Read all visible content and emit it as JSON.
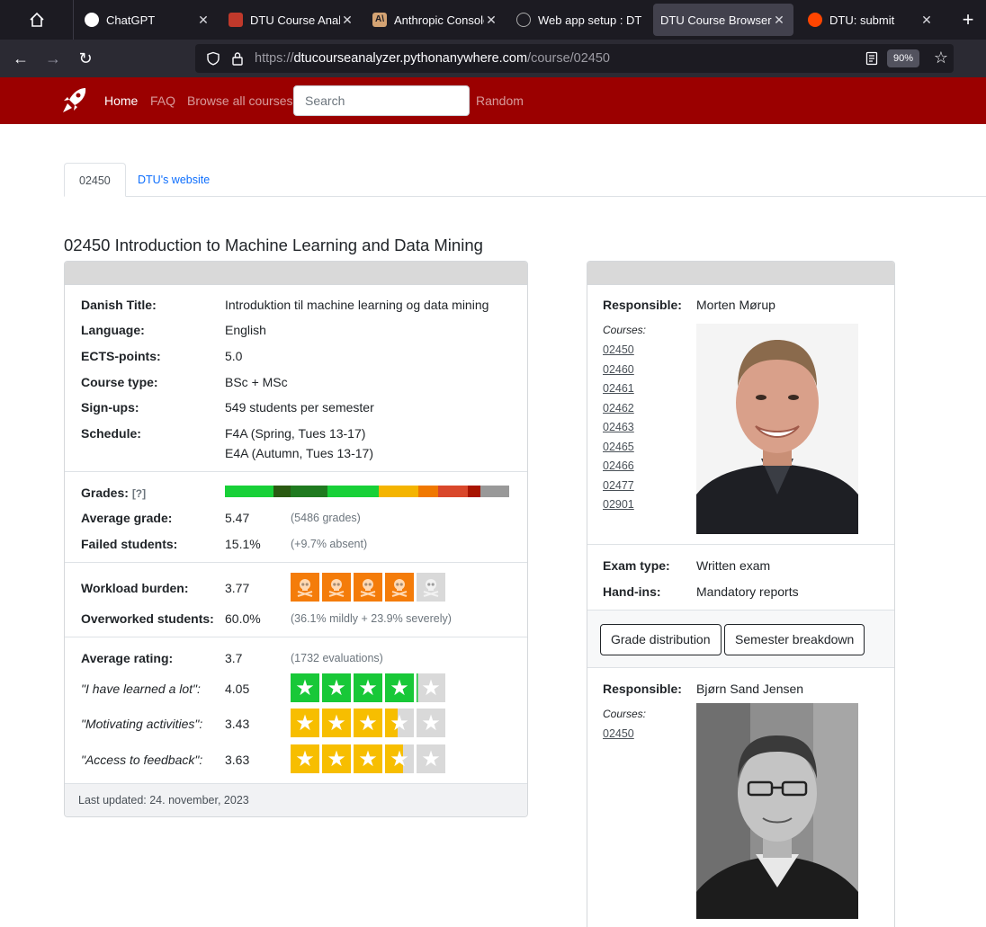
{
  "browser": {
    "tabs": [
      {
        "title": "ChatGPT",
        "color": "#ffffff"
      },
      {
        "title": "DTU Course Analyze",
        "color": "#c0392b"
      },
      {
        "title": "Anthropic Console",
        "color": "#d4a373"
      },
      {
        "title": "Web app setup : DTU",
        "color": "#1c1b22"
      },
      {
        "title": "DTU Course Browser",
        "color": "#42414d"
      },
      {
        "title": "DTU: submit",
        "color": "#ff4500"
      }
    ],
    "url_scheme": "https://",
    "url_domain": "dtucourseanalyzer.pythonanywhere.com",
    "url_path": "/course/02450",
    "zoom": "90%"
  },
  "nav": {
    "home": "Home",
    "faq": "FAQ",
    "browse": "Browse all courses",
    "search_placeholder": "Search",
    "random": "Random"
  },
  "tabs": {
    "active": "02450",
    "link": "DTU's website"
  },
  "course_title": "02450 Introduction to Machine Learning and Data Mining",
  "info": {
    "danish_title_label": "Danish Title:",
    "danish_title": "Introduktion til machine learning og data mining",
    "language_label": "Language:",
    "language": "English",
    "ects_label": "ECTS-points:",
    "ects": "5.0",
    "type_label": "Course type:",
    "type": "BSc + MSc",
    "signups_label": "Sign-ups:",
    "signups": "549 students per semester",
    "schedule_label": "Schedule:",
    "schedule_1": "F4A (Spring, Tues 13-17)",
    "schedule_2": "E4A (Autumn, Tues 13-17)"
  },
  "grades": {
    "label": "Grades:",
    "help": "[?]",
    "avg_label": "Average grade:",
    "avg": "5.47",
    "avg_note": "(5486 grades)",
    "failed_label": "Failed students:",
    "failed": "15.1%",
    "failed_note": "(+9.7% absent)",
    "distribution": [
      {
        "fraction": 0.17,
        "color": "#18d038"
      },
      {
        "fraction": 0.06,
        "color": "#2a5a12"
      },
      {
        "fraction": 0.13,
        "color": "#1f7a1f"
      },
      {
        "fraction": 0.18,
        "color": "#18d038"
      },
      {
        "fraction": 0.14,
        "color": "#f4b400"
      },
      {
        "fraction": 0.07,
        "color": "#f07800"
      },
      {
        "fraction": 0.105,
        "color": "#d9472b"
      },
      {
        "fraction": 0.045,
        "color": "#a81400"
      },
      {
        "fraction": 0.1,
        "color": "#999999"
      }
    ]
  },
  "workload": {
    "label": "Workload burden:",
    "value": "3.77",
    "level": 3.77,
    "over_label": "Overworked students:",
    "over": "60.0%",
    "over_note": "(36.1% mildly + 23.9% severely)"
  },
  "rating": {
    "label": "Average rating:",
    "value": "3.7",
    "note": "(1732 evaluations)",
    "items": [
      {
        "label": "\"I have learned a lot\":",
        "value": "4.05",
        "level": 4.05,
        "color": "#18c838"
      },
      {
        "label": "\"Motivating activities\":",
        "value": "3.43",
        "level": 3.43,
        "color": "#f7be00"
      },
      {
        "label": "\"Access to feedback\":",
        "value": "3.63",
        "level": 3.63,
        "color": "#f7be00"
      }
    ]
  },
  "last_updated": "Last updated: 24. november, 2023",
  "responsible_1": {
    "label": "Responsible:",
    "name": "Morten Mørup",
    "courses_label": "Courses:",
    "courses": [
      "02450",
      "02460",
      "02461",
      "02462",
      "02463",
      "02465",
      "02466",
      "02477",
      "02901"
    ]
  },
  "exam": {
    "type_label": "Exam type:",
    "type": "Written exam",
    "handins_label": "Hand-ins:",
    "handins": "Mandatory reports"
  },
  "buttons": {
    "grade_dist": "Grade distribution",
    "semester": "Semester breakdown"
  },
  "responsible_2": {
    "label": "Responsible:",
    "name": "Bjørn Sand Jensen",
    "courses_label": "Courses:",
    "courses": [
      "02450"
    ]
  }
}
